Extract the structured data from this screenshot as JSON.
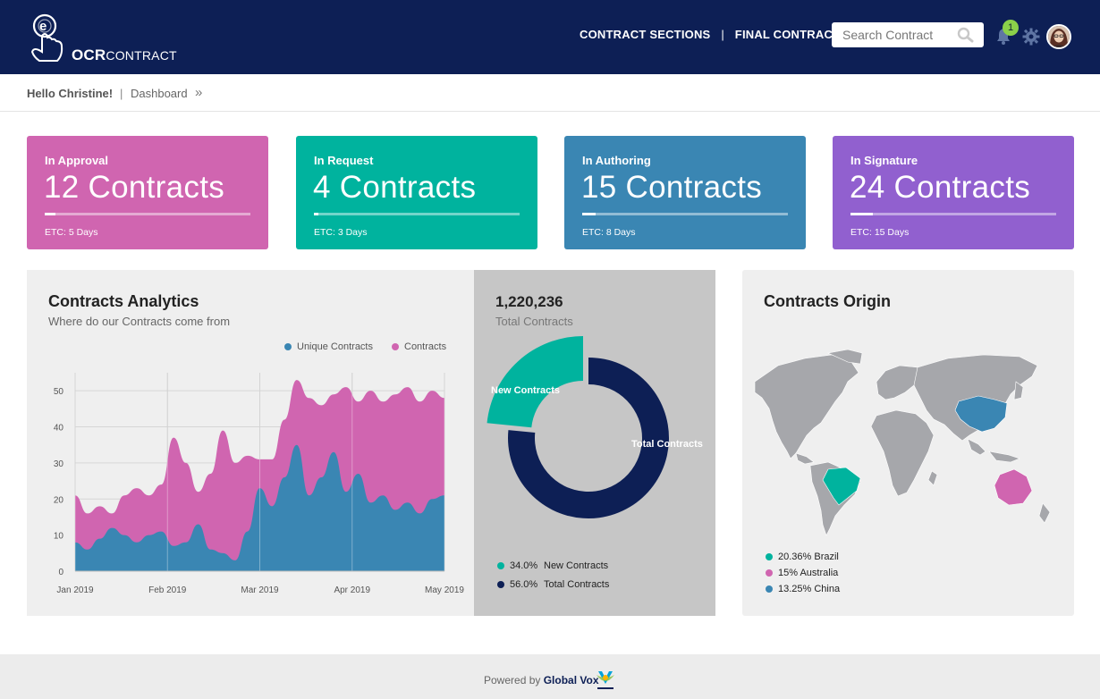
{
  "header": {
    "logo_bold": "OCR",
    "logo_light": "CONTRACT",
    "nav": [
      "CONTRACT SECTIONS",
      "FINAL CONTRACTS"
    ],
    "nav_separator": "|",
    "search_placeholder": "Search Contract",
    "notification_count": "1",
    "bg_color": "#0d1f55"
  },
  "breadcrumb": {
    "greeting": "Hello Christine!",
    "separator": "|",
    "current": "Dashboard",
    "arrow": "»"
  },
  "cards": [
    {
      "label": "In Approval",
      "value": "12 Contracts",
      "etc": "ETC: 5 Days",
      "color": "#d065b0",
      "progress": 0.05
    },
    {
      "label": "In Request",
      "value": "4 Contracts",
      "etc": "ETC: 3 Days",
      "color": "#00b39e",
      "progress": 0.02
    },
    {
      "label": "In Authoring",
      "value": "15 Contracts",
      "etc": "ETC: 8 Days",
      "color": "#3a86b3",
      "progress": 0.065
    },
    {
      "label": "In Signature",
      "value": "24 Contracts",
      "etc": "ETC: 15 Days",
      "color": "#9160cf",
      "progress": 0.11
    }
  ],
  "analytics": {
    "title": "Contracts Analytics",
    "subtitle": "Where do our Contracts come from",
    "legend": [
      {
        "name": "Unique Contracts",
        "color": "#3a86b3"
      },
      {
        "name": "Contracts",
        "color": "#d065b0"
      }
    ]
  },
  "total": {
    "value": "1,220,236",
    "label": "Total Contracts",
    "donut_labels": [
      "New Contracts",
      "Total Contracts"
    ],
    "legend": [
      {
        "pct": "34.0%",
        "name": "New Contracts",
        "color": "#00b39e"
      },
      {
        "pct": "56.0%",
        "name": "Total Contracts",
        "color": "#0d1f55"
      }
    ]
  },
  "origin": {
    "title": "Contracts Origin",
    "legend": [
      {
        "text": "20.36% Brazil",
        "color": "#00b39e"
      },
      {
        "text": "15% Australia",
        "color": "#d065b0"
      },
      {
        "text": "13.25% China",
        "color": "#3a86b3"
      }
    ]
  },
  "footer": {
    "powered": "Powered by",
    "brand": "Global Vox"
  },
  "chart_data": [
    {
      "type": "area",
      "x": [
        "2019-01-01",
        "2019-01-05",
        "2019-01-09",
        "2019-01-13",
        "2019-01-17",
        "2019-01-21",
        "2019-01-25",
        "2019-01-29",
        "2019-02-02",
        "2019-02-06",
        "2019-02-10",
        "2019-02-14",
        "2019-02-18",
        "2019-02-22",
        "2019-02-26",
        "2019-03-02",
        "2019-03-06",
        "2019-03-10",
        "2019-03-14",
        "2019-03-18",
        "2019-03-22",
        "2019-03-26",
        "2019-03-30",
        "2019-04-03",
        "2019-04-07",
        "2019-04-11",
        "2019-04-15",
        "2019-04-19",
        "2019-04-23",
        "2019-04-27",
        "2019-05-01"
      ],
      "xticks": [
        "Jan 2019",
        "Feb 2019",
        "Mar 2019",
        "Apr 2019",
        "May 2019"
      ],
      "ylim": [
        0,
        55
      ],
      "yticks": [
        0,
        10,
        20,
        30,
        40,
        50
      ],
      "series": [
        {
          "name": "Unique Contracts",
          "values": [
            8,
            6,
            9,
            12,
            10,
            8,
            10,
            11,
            7,
            8,
            13,
            6,
            5,
            3,
            11,
            23,
            18,
            26,
            35,
            21,
            26,
            33,
            22,
            27,
            19,
            21,
            17,
            19,
            16,
            20,
            21
          ]
        },
        {
          "name": "Contracts",
          "values": [
            21,
            16,
            18,
            16,
            21,
            23,
            21,
            24,
            37,
            30,
            22,
            27,
            39,
            30,
            32,
            31,
            31,
            42,
            53,
            48,
            46,
            49,
            51,
            47,
            50,
            47,
            49,
            51,
            47,
            50,
            48
          ]
        }
      ]
    },
    {
      "type": "pie",
      "categories": [
        "New Contracts",
        "Total Contracts"
      ],
      "values": [
        34.0,
        56.0
      ]
    }
  ]
}
